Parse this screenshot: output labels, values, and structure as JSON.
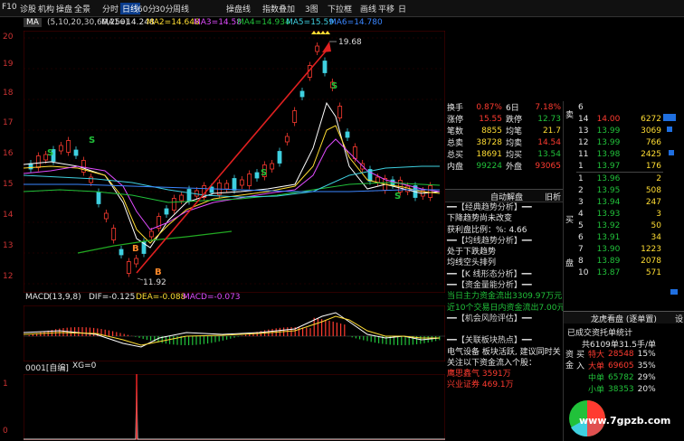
{
  "toolbar": {
    "left": [
      "F10",
      "诊股",
      "机构",
      "操盘",
      "全景"
    ],
    "right": [
      "分时",
      "日线",
      "60分",
      "30分",
      "周线",
      "操盘线",
      "指数叠加",
      "3图",
      "下拉框",
      "画线",
      "平移",
      "日"
    ]
  },
  "ma_bar": {
    "selector": "MA",
    "params": "(5,10,20,30,60,250)",
    "ma1": "MA1=14.248",
    "ma2": "MA2=14.648",
    "ma3": "MA3=14.58",
    "ma4": "MA4=14.934",
    "ma5": "MA5=15.59",
    "ma6": "MA6=14.780"
  },
  "price_axis": [
    "20",
    "19",
    "18",
    "17",
    "16",
    "15",
    "14",
    "13",
    "12"
  ],
  "annotations": {
    "high": "19.68",
    "low": "11.92",
    "s": "S",
    "b": "B"
  },
  "macd": {
    "label": "MACD",
    "params": "(13,9,8)",
    "dif": "DIF=-0.125",
    "dea": "DEA=-0.088",
    "macd": "MACD=-0.073"
  },
  "indicator": {
    "label": "0001[自编]",
    "xg": "XG=0",
    "axis": [
      "1",
      "0"
    ]
  },
  "stats": [
    {
      "l1": "换手",
      "v1": "0.87%",
      "l2": "6日",
      "v2": "7.18%"
    },
    {
      "l1": "涨停",
      "v1": "15.55",
      "l2": "跌停",
      "v2": "12.73"
    },
    {
      "l1": "笔数",
      "v1": "8855",
      "l2": "均笔",
      "v2": "21.7"
    },
    {
      "l1": "总卖",
      "v1": "38728",
      "l2": "均卖",
      "v2": "14.54"
    },
    {
      "l1": "总买",
      "v1": "18691",
      "l2": "均买",
      "v2": "13.54"
    },
    {
      "l1": "内盘",
      "v1": "99224",
      "l2": "外盘",
      "v2": "93065"
    }
  ],
  "auto_panel": {
    "title": "自动解盘",
    "tab": "旧析",
    "s1": "━━【经典趋势分析】━━",
    "t1a": "下降趋势尚未改变",
    "t1b": "获利盘比例：%: 4.66",
    "s2": "━━【均线趋势分析】━━",
    "t2a": "处于下跌趋势",
    "t2b": "均线空头排列",
    "s3": "━━【K 线形态分析】━━",
    "s4": "━━【资金量能分析】━━",
    "t4a": "当日主力资金流出3309.97万元",
    "t4b": "近10个交易日内资金流出7.00元",
    "s5": "━━【机会风险评估】━━",
    "s6": "━━【关联板块热点】━━",
    "t6a": "电气设备 板块活跃, 建议同时关",
    "t6b": "关注以下资金流入个股：",
    "t6c": "鹰思鑫气 3591万",
    "t6d": "兴业证券 469.1万"
  },
  "orderbook": {
    "label_sell": "卖",
    "label_buy": "买",
    "label_pan": "盘",
    "rows": [
      {
        "idx": "6",
        "price": "",
        "vol": "",
        "color": "red"
      },
      {
        "idx": "14",
        "price": "14.00",
        "vol": "6272",
        "color": "red"
      },
      {
        "idx": "13",
        "price": "13.99",
        "vol": "3069",
        "color": "green"
      },
      {
        "idx": "12",
        "price": "13.99",
        "vol": "766",
        "color": "green"
      },
      {
        "idx": "11",
        "price": "13.98",
        "vol": "2425",
        "color": "green"
      },
      {
        "idx": "1",
        "price": "13.97",
        "vol": "176",
        "color": "green"
      },
      {
        "idx": "1",
        "price": "13.96",
        "vol": "2",
        "color": "green"
      },
      {
        "idx": "2",
        "price": "13.95",
        "vol": "508",
        "color": "green"
      },
      {
        "idx": "3",
        "price": "13.94",
        "vol": "247",
        "color": "green"
      },
      {
        "idx": "4",
        "price": "13.93",
        "vol": "3",
        "color": "green"
      },
      {
        "idx": "5",
        "price": "13.92",
        "vol": "50",
        "color": "green"
      },
      {
        "idx": "6",
        "price": "13.91",
        "vol": "34",
        "color": "green"
      },
      {
        "idx": "7",
        "price": "13.90",
        "vol": "1223",
        "color": "green"
      },
      {
        "idx": "8",
        "price": "13.89",
        "vol": "2078",
        "color": "green"
      },
      {
        "idx": "10",
        "price": "13.87",
        "vol": "571",
        "color": "green"
      }
    ]
  },
  "dragon": {
    "title": "龙虎看盘 (逐单置)",
    "tab": "设",
    "subtitle": "已成交资托单统计",
    "count": "共6109单31.5手/单",
    "side_label": "资金",
    "rows": [
      {
        "side": "买",
        "label": "特大",
        "vol": "28548",
        "pct": "15%"
      },
      {
        "side": "入",
        "label": "大单",
        "vol": "69605",
        "pct": "35%"
      },
      {
        "side": "",
        "label": "中单",
        "vol": "65782",
        "pct": "29%"
      },
      {
        "side": "",
        "label": "小单",
        "vol": "38353",
        "pct": "20%"
      }
    ]
  },
  "watermark": "www.7gpzb.com",
  "colors": {
    "up": "#ff3b30",
    "down": "#21c13a",
    "bg": "#000000",
    "arrow": "#e02020",
    "ma_white": "#ffffff",
    "ma_yellow": "#ffdd33",
    "ma_magenta": "#e04cff",
    "ma_green": "#21c13a",
    "ma_cyan": "#3fd0e0"
  }
}
